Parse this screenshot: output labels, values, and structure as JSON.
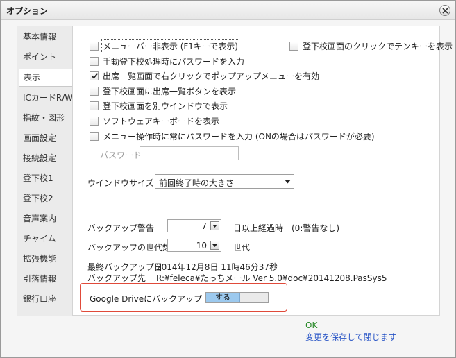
{
  "window": {
    "title": "オプション"
  },
  "sidebar": {
    "items": [
      {
        "label": "基本情報",
        "active": false
      },
      {
        "label": "ポイント",
        "active": false
      },
      {
        "label": "表示",
        "active": true
      },
      {
        "label": "ICカードR/W",
        "active": false
      },
      {
        "label": "指紋・図形",
        "active": false
      },
      {
        "label": "画面設定",
        "active": false
      },
      {
        "label": "接続設定",
        "active": false
      },
      {
        "label": "登下校1",
        "active": false
      },
      {
        "label": "登下校2",
        "active": false
      },
      {
        "label": "音声案内",
        "active": false
      },
      {
        "label": "チャイム",
        "active": false
      },
      {
        "label": "拡張機能",
        "active": false
      },
      {
        "label": "引落情報",
        "active": false
      },
      {
        "label": "銀行口座",
        "active": false
      }
    ]
  },
  "display": {
    "checkboxes": [
      {
        "label": "メニューバー非表示 (F1キーで表示)",
        "checked": false
      },
      {
        "label": "手動登下校処理時にパスワードを入力",
        "checked": false
      },
      {
        "label": "出席一覧画面で右クリックでポップアップメニューを有効",
        "checked": true
      },
      {
        "label": "登下校画面に出席一覧ボタンを表示",
        "checked": false
      },
      {
        "label": "登下校画面を別ウインドウで表示",
        "checked": false
      },
      {
        "label": "ソフトウェアキーボードを表示",
        "checked": false
      },
      {
        "label": "メニュー操作時に常にパスワードを入力 (ONの場合はパスワードが必要)",
        "checked": false
      }
    ],
    "right_checkbox": {
      "label": "登下校画面のクリックでテンキーを表示",
      "checked": false
    },
    "password_label": "パスワード",
    "password_value": "",
    "window_size_label": "ウインドウサイズ",
    "window_size_value": "前回終了時の大きさ",
    "backup_warning_label": "バックアップ警告",
    "backup_warning_value": "7",
    "backup_warning_suffix": "日以上経過時　(0:警告なし)",
    "backup_generations_label": "バックアップの世代数",
    "backup_generations_value": "10",
    "backup_generations_suffix": "世代",
    "last_backup_label": "最終バックアップ日",
    "last_backup_value": "2014年12月8日 11時46分37秒",
    "backup_dest_label": "バックアップ先",
    "backup_dest_value": "R:¥feleca¥たっちメール Ver 5.0¥doc¥20141208.PasSys5",
    "gdrive_label": "Google Driveにバックアップ",
    "gdrive_toggle_label": "する"
  },
  "footer": {
    "ok_label": "OK",
    "save_label": "変更を保存して閉じます"
  },
  "colors": {
    "highlight_border": "#e04a3a",
    "toggle_on": "#9cc9ee",
    "ok_text": "#2a8a2a",
    "save_text": "#2a56c6"
  }
}
